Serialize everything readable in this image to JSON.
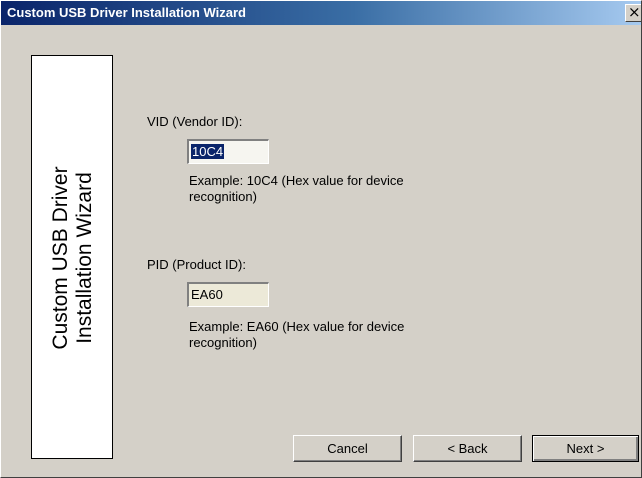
{
  "window": {
    "title": "Custom USB Driver Installation Wizard",
    "close_label": "×"
  },
  "sidebar": {
    "line1": "Custom USB Driver",
    "line2": "Installation Wizard"
  },
  "vid": {
    "label": "VID (Vendor ID):",
    "value": "10C4",
    "hint": "Example: 10C4 (Hex value for device recognition)"
  },
  "pid": {
    "label": "PID (Product ID):",
    "value": "EA60",
    "hint": "Example: EA60 (Hex value for device recognition)"
  },
  "buttons": {
    "cancel": "Cancel",
    "back": "< Back",
    "next": "Next >"
  },
  "colors": {
    "title_bar": "#0a246a",
    "face": "#d4d0c8",
    "selection": "#0a246a"
  }
}
